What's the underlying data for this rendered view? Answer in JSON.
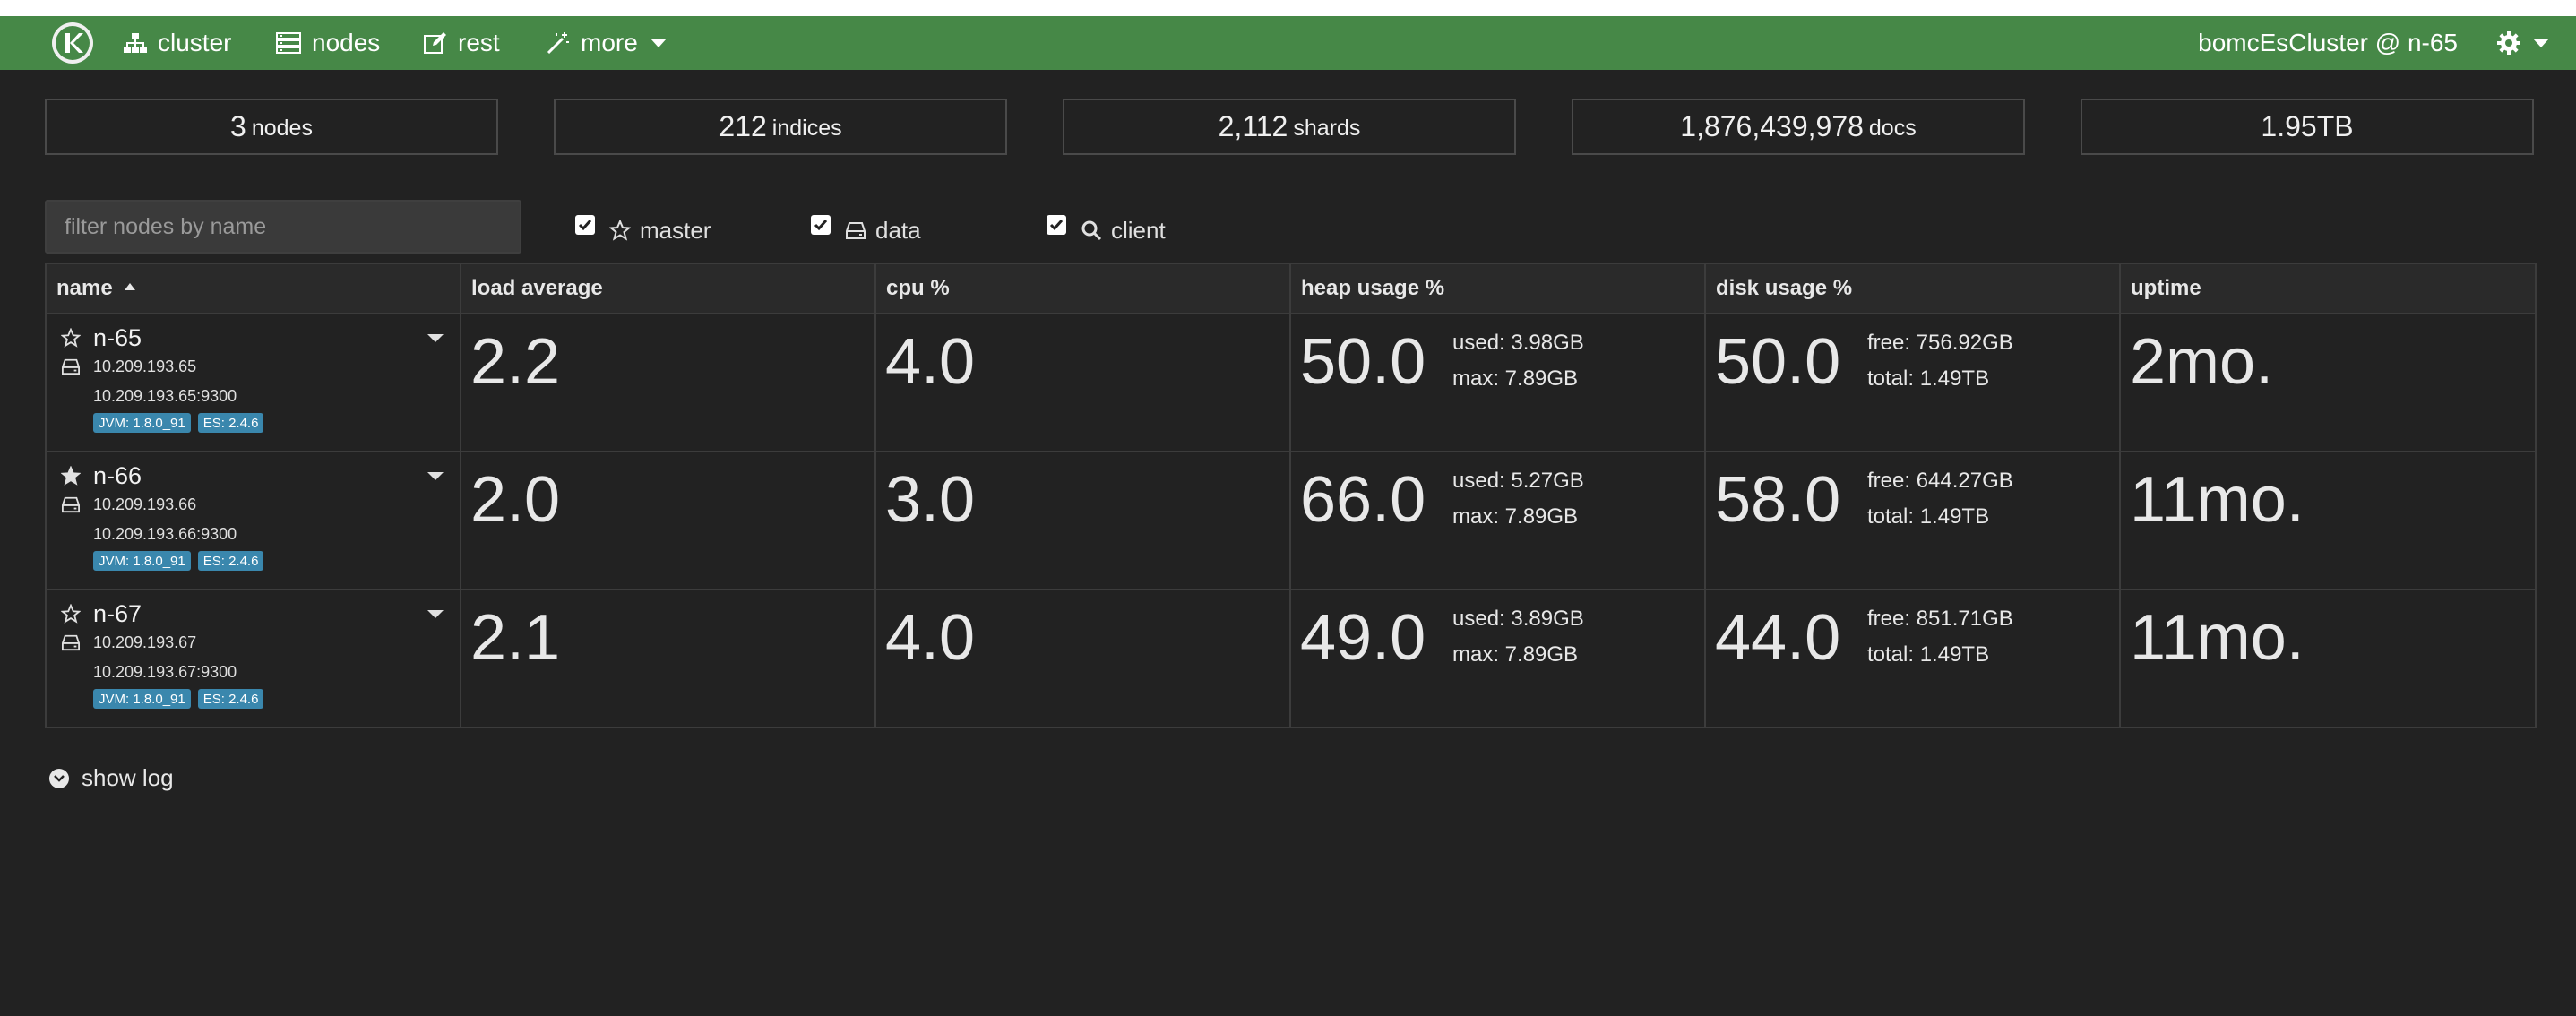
{
  "nav": {
    "items": [
      {
        "label": "cluster",
        "icon": "sitemap-icon"
      },
      {
        "label": "nodes",
        "icon": "server-icon"
      },
      {
        "label": "rest",
        "icon": "edit-icon"
      },
      {
        "label": "more",
        "icon": "magic-wand-icon"
      }
    ],
    "cluster_label": "bomcEsCluster @ n-65",
    "accent": "#468847"
  },
  "stats": [
    {
      "value": "3",
      "label": "nodes"
    },
    {
      "value": "212",
      "label": "indices"
    },
    {
      "value": "2,112",
      "label": "shards"
    },
    {
      "value": "1,876,439,978",
      "label": "docs"
    },
    {
      "value": "1.95TB",
      "label": ""
    }
  ],
  "filter": {
    "placeholder": "filter nodes by name",
    "value": ""
  },
  "toggles": [
    {
      "label": "master",
      "icon": "star-outline-icon",
      "checked": true
    },
    {
      "label": "data",
      "icon": "hdd-icon",
      "checked": true
    },
    {
      "label": "client",
      "icon": "search-icon",
      "checked": true
    }
  ],
  "table": {
    "headers": [
      "name",
      "load average",
      "cpu %",
      "heap usage %",
      "disk usage %",
      "uptime"
    ],
    "rows": [
      {
        "name": "n-65",
        "ip": "10.209.193.65",
        "addr": "10.209.193.65:9300",
        "master_icon": "star-outline-icon",
        "jvm": "JVM: 1.8.0_91",
        "es": "ES: 2.4.6",
        "load": "2.2",
        "cpu": "4.0",
        "heap": "50.0",
        "heap_used": "used: 3.98GB",
        "heap_max": "max: 7.89GB",
        "disk": "50.0",
        "disk_free": "free: 756.92GB",
        "disk_total": "total: 1.49TB",
        "uptime": "2mo."
      },
      {
        "name": "n-66",
        "ip": "10.209.193.66",
        "addr": "10.209.193.66:9300",
        "master_icon": "star-filled-icon",
        "jvm": "JVM: 1.8.0_91",
        "es": "ES: 2.4.6",
        "load": "2.0",
        "cpu": "3.0",
        "heap": "66.0",
        "heap_used": "used: 5.27GB",
        "heap_max": "max: 7.89GB",
        "disk": "58.0",
        "disk_free": "free: 644.27GB",
        "disk_total": "total: 1.49TB",
        "uptime": "11mo."
      },
      {
        "name": "n-67",
        "ip": "10.209.193.67",
        "addr": "10.209.193.67:9300",
        "master_icon": "star-outline-icon",
        "jvm": "JVM: 1.8.0_91",
        "es": "ES: 2.4.6",
        "load": "2.1",
        "cpu": "4.0",
        "heap": "49.0",
        "heap_used": "used: 3.89GB",
        "heap_max": "max: 7.89GB",
        "disk": "44.0",
        "disk_free": "free: 851.71GB",
        "disk_total": "total: 1.49TB",
        "uptime": "11mo."
      }
    ]
  },
  "show_log": "show log"
}
